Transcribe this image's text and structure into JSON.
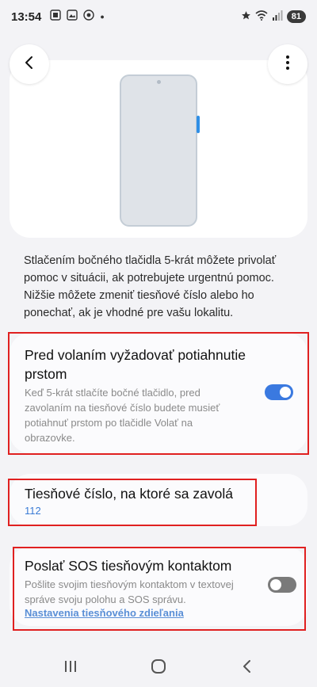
{
  "status_bar": {
    "time": "13:54",
    "battery": "81",
    "left_icons": [
      "screenshot-icon",
      "gallery-icon",
      "chrome-icon"
    ],
    "right_icons": [
      "star-icon",
      "wifi-icon",
      "signal-icon"
    ]
  },
  "header": {
    "back_icon": "back-arrow-icon",
    "more_icon": "more-vertical-icon"
  },
  "description": "Stlačením bočného tlačidla 5-krát môžete privolať pomoc v situácii, ak potrebujete urgentnú pomoc. Nižšie môžete zmeniť tiesňové číslo alebo ho ponechať, ak je vhodné pre vašu lokalitu.",
  "settings": [
    {
      "title_line1": "Pred volaním vyžadovať potiahnutie",
      "title_line2": "prstom",
      "subtitle_lines": [
        "Keď 5-krát stlačíte bočné tlačidlo, pred",
        "zavolaním na tiesňové číslo budete musieť",
        "potiahnuť prstom po tlačidle Volať na",
        "obrazovke."
      ],
      "toggle_on": true
    },
    {
      "title": "Tiesňové číslo, na ktoré sa zavolá",
      "value": "112"
    },
    {
      "title": "Poslať SOS tiesňovým kontaktom",
      "subtitle_lines": [
        "Pošlite svojim tiesňovým kontaktom v textovej",
        "správe svoju polohu a SOS správu."
      ],
      "link": "Nastavenia tiesňového zdieľania",
      "toggle_on": false
    }
  ],
  "colors": {
    "accent": "#3a79e0",
    "highlight": "#e02020",
    "background": "#f3f3f6"
  }
}
